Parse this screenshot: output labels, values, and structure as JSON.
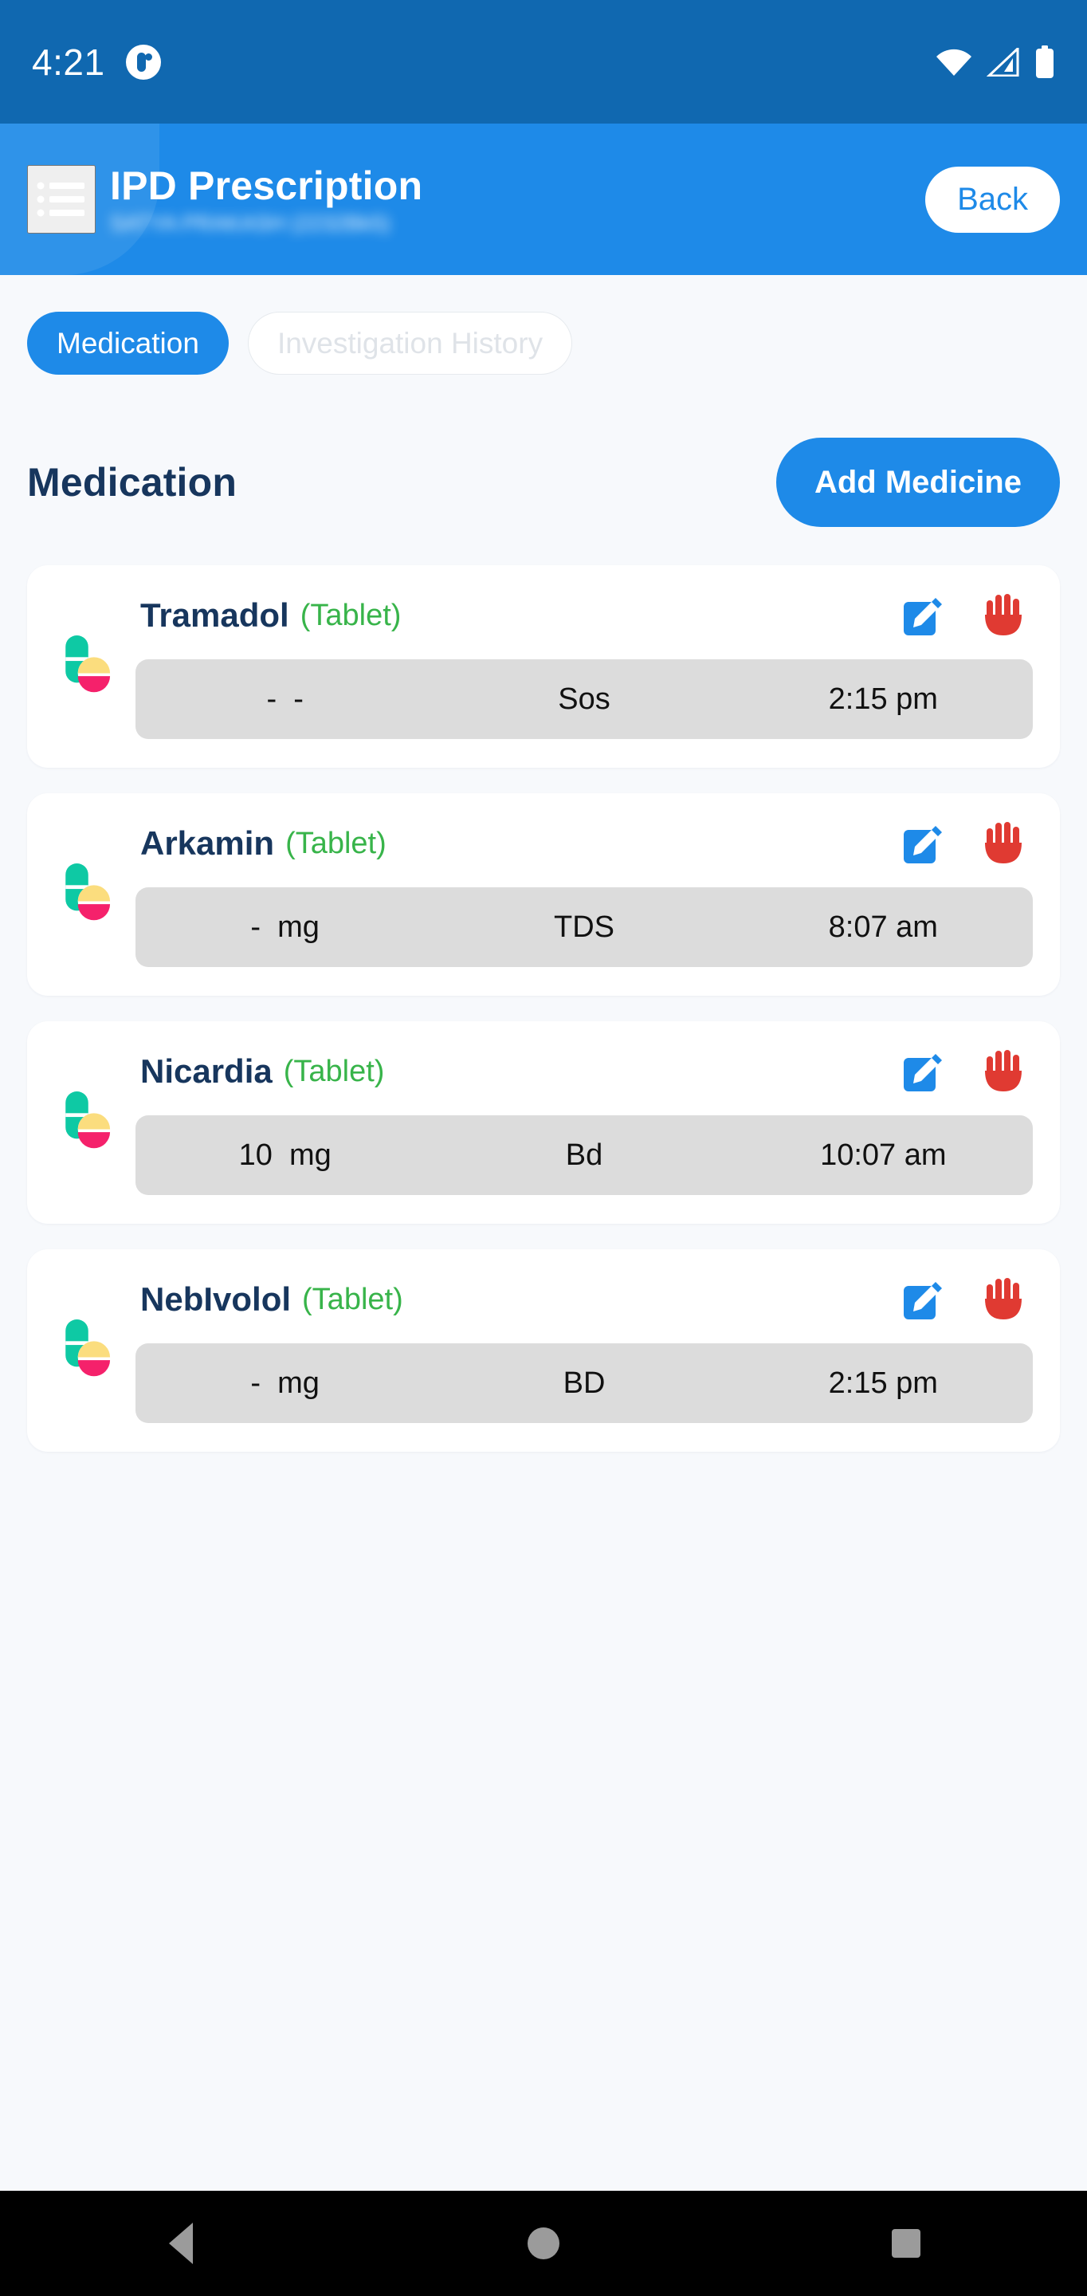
{
  "status_bar": {
    "time": "4:21",
    "app_icon": "app-notification-icon",
    "wifi_icon": "wifi-icon",
    "signal_icon": "cellular-signal-icon",
    "battery_icon": "battery-full-icon"
  },
  "app_bar": {
    "menu_icon": "hamburger-list-icon",
    "title": "IPD Prescription",
    "subtitle_blurred": "SATYA PRAKASH (2232Bk5)",
    "back_label": "Back"
  },
  "tabs": [
    {
      "label": "Medication",
      "active": true
    },
    {
      "label": "Investigation History",
      "active": false
    }
  ],
  "section": {
    "title": "Medication",
    "add_button_label": "Add Medicine"
  },
  "medications": [
    {
      "name": "Tramadol",
      "form": "(Tablet)",
      "dose": "-  -",
      "frequency": "Sos",
      "time": "2:15 pm",
      "edit_icon": "edit-pencil-icon",
      "stop_icon": "stop-hand-icon",
      "pill_icon": "pill-capsule-icon"
    },
    {
      "name": "Arkamin",
      "form": "(Tablet)",
      "dose": "-  mg",
      "frequency": "TDS",
      "time": "8:07 am",
      "edit_icon": "edit-pencil-icon",
      "stop_icon": "stop-hand-icon",
      "pill_icon": "pill-capsule-icon"
    },
    {
      "name": "Nicardia",
      "form": "(Tablet)",
      "dose": "10  mg",
      "frequency": "Bd",
      "time": "10:07 am",
      "edit_icon": "edit-pencil-icon",
      "stop_icon": "stop-hand-icon",
      "pill_icon": "pill-capsule-icon"
    },
    {
      "name": "NebIvolol",
      "form": "(Tablet)",
      "dose": "-  mg",
      "frequency": "BD",
      "time": "2:15 pm",
      "edit_icon": "edit-pencil-icon",
      "stop_icon": "stop-hand-icon",
      "pill_icon": "pill-capsule-icon"
    }
  ],
  "nav_bar": {
    "back_icon": "nav-back-triangle-icon",
    "home_icon": "nav-home-circle-icon",
    "recents_icon": "nav-recents-square-icon"
  },
  "colors": {
    "status_bar_bg": "#1068b0",
    "app_bar_bg": "#1e8ae8",
    "accent_blue": "#1e8ae8",
    "page_bg": "#f7f9fc",
    "card_bg": "#ffffff",
    "detail_bar_bg": "#dcdcdc",
    "title_navy": "#17365d",
    "form_green": "#38b44a",
    "stop_red": "#e03a32",
    "nav_bar_bg": "#000000"
  }
}
